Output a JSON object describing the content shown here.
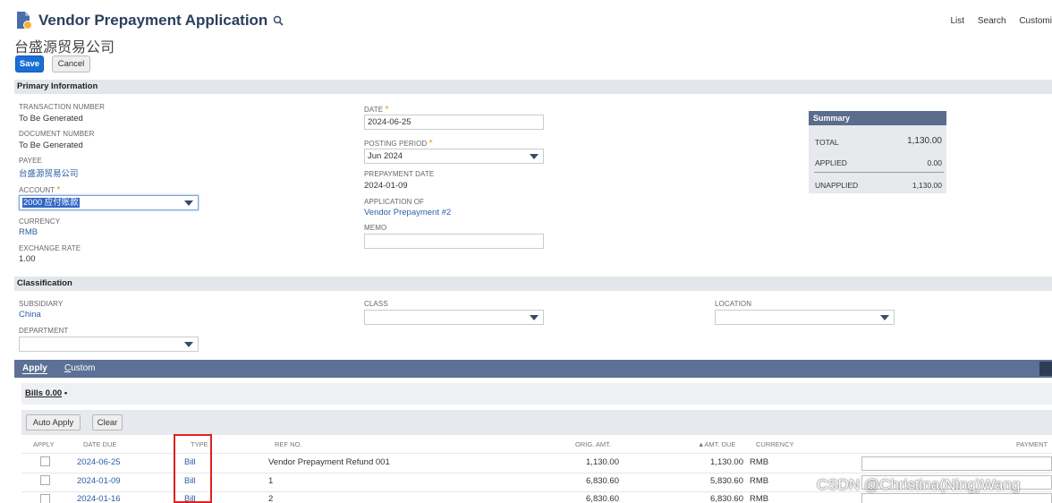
{
  "header": {
    "title": "Vendor Prepayment Application",
    "subtitle": "台盛源贸易公司",
    "top_links": [
      "List",
      "Search",
      "Customi"
    ],
    "save_label": "Save",
    "cancel_label": "Cancel"
  },
  "primary": {
    "section_title": "Primary Information",
    "transaction_number_label": "TRANSACTION NUMBER",
    "transaction_number": "To Be Generated",
    "document_number_label": "DOCUMENT NUMBER",
    "document_number": "To Be Generated",
    "payee_label": "PAYEE",
    "payee": "台盛源贸易公司",
    "account_label": "ACCOUNT",
    "account": "2000 应付账款",
    "currency_label": "CURRENCY",
    "currency": "RMB",
    "exchange_rate_label": "EXCHANGE RATE",
    "exchange_rate": "1.00",
    "date_label": "DATE",
    "date": "2024-06-25",
    "posting_period_label": "POSTING PERIOD",
    "posting_period": "Jun 2024",
    "prepayment_date_label": "PREPAYMENT DATE",
    "prepayment_date": "2024-01-09",
    "application_of_label": "APPLICATION OF",
    "application_of": "Vendor Prepayment #2",
    "memo_label": "MEMO",
    "memo": "",
    "required_mark": "*"
  },
  "summary": {
    "title": "Summary",
    "total_label": "TOTAL",
    "total": "1,130.00",
    "applied_label": "APPLIED",
    "applied": "0.00",
    "unapplied_label": "UNAPPLIED",
    "unapplied": "1,130.00"
  },
  "classification": {
    "section_title": "Classification",
    "subsidiary_label": "SUBSIDIARY",
    "subsidiary": "China",
    "department_label": "DEPARTMENT",
    "class_label": "CLASS",
    "location_label": "LOCATION"
  },
  "tabs": {
    "apply": "Apply",
    "custom_first": "C",
    "custom_rest": "ustom"
  },
  "bills": {
    "subtab_label": "Bills 0.00",
    "subtab_dot": "•",
    "auto_apply": "Auto Apply",
    "clear": "Clear",
    "columns": [
      "APPLY",
      "DATE DUE",
      "TYPE",
      "REF NO.",
      "ORIG. AMT.",
      "▲AMT. DUE",
      "CURRENCY",
      "PAYMENT"
    ],
    "rows": [
      {
        "date_due": "2024-06-25",
        "type": "Bill",
        "ref_no": "Vendor Prepayment Refund 001",
        "orig_amt": "1,130.00",
        "amt_due": "1,130.00",
        "currency": "RMB"
      },
      {
        "date_due": "2024-01-09",
        "type": "Bill",
        "ref_no": "1",
        "orig_amt": "6,830.60",
        "amt_due": "5,830.60",
        "currency": "RMB"
      },
      {
        "date_due": "2024-01-16",
        "type": "Bill",
        "ref_no": "2",
        "orig_amt": "6,830.60",
        "amt_due": "6,830.60",
        "currency": "RMB"
      }
    ]
  },
  "watermark": "CSDN @Christina(Ning)Wang",
  "colors": {
    "brand_blue": "#1a6fd6",
    "tab_bar": "#5c7195",
    "summary_head": "#5a6d8c",
    "highlight_red": "#e02020",
    "link": "#2b5fa6"
  },
  "icons": [
    "vendor-document-icon",
    "search-icon",
    "dropdown-caret-icon",
    "list-options-icon"
  ]
}
